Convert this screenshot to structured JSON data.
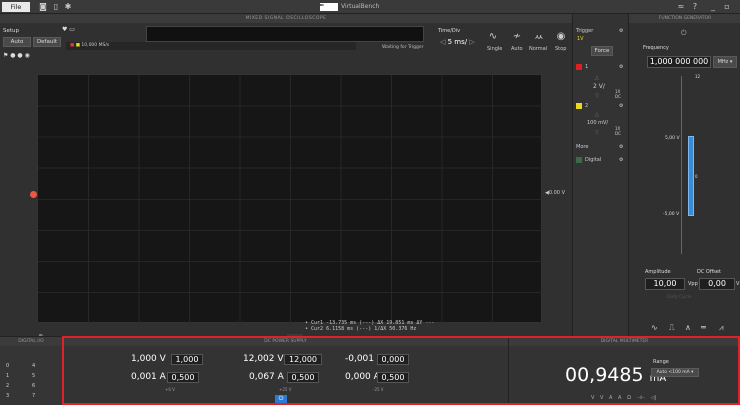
{
  "topbar": {
    "file_label": "File",
    "app_title": "VirtualBench",
    "logo_text": "NATIONAL INSTRUMENTS"
  },
  "scope": {
    "header": "MIXED SIGNAL OSCILLOSCOPE",
    "setup_label": "Setup",
    "auto_label": "Auto",
    "default_label": "Default",
    "sample_rate": "10,000 MS/s",
    "status": "Waiting for Trigger",
    "timediv_label": "Time/Div",
    "timediv_value": "5 ms/",
    "modes": [
      "Single",
      "Auto",
      "Normal",
      "Stop"
    ],
    "ref_label": "0.00 V",
    "cursor_lines": [
      "• Cur1  -13.735 ms (---)   ΔX 19.851 ms   ΔY ---",
      "• Cur2   6.1158 ms (---)   1/ΔX 50.376 Hz"
    ]
  },
  "side": {
    "trigger_label": "Trigger",
    "trigger_level": "1V",
    "force_label": "Force",
    "ch1_label": "1",
    "ch1_scale": "2 V/",
    "ch1_coupling": "1X DC",
    "ch2_label": "2",
    "ch2_scale": "100 mV/",
    "ch2_coupling": "1X DC",
    "more_label": "More",
    "digital_label": "Digital",
    "ch1_color": "#e02020",
    "ch2_color": "#e8d820"
  },
  "fgen": {
    "header": "FUNCTION GENERATOR",
    "frequency_label": "Frequency",
    "frequency_value": "1,000 000 000",
    "frequency_unit": "MHz ▾",
    "top_tick": "12",
    "upper_level": "5,00 V",
    "lower_level": "-5,00 V",
    "mid_tick": "0",
    "amplitude_label": "Amplitude",
    "amplitude_value": "10,00",
    "amplitude_unit": "Vpp",
    "dc_offset_label": "DC Offset",
    "dc_offset_value": "0,00",
    "dc_offset_unit": "V",
    "duty_cycle_label": "Duty Cycle",
    "waveforms": [
      "∿",
      "⎍",
      "∧",
      "═",
      "⩘"
    ]
  },
  "dio": {
    "header": "DIGITAL I/O",
    "pins": [
      "0",
      "1",
      "2",
      "3",
      "4",
      "5",
      "6",
      "7"
    ]
  },
  "dcps": {
    "header": "DC POWER SUPPLY",
    "channels": [
      {
        "voltage": "1,000 V",
        "voltage_set": "1,000",
        "current": "0,001 A",
        "current_set": "0,500",
        "label": "+6 V"
      },
      {
        "voltage": "12,002 V",
        "voltage_set": "12,000",
        "current": "0,067 A",
        "current_set": "0,500",
        "label": "+25 V"
      },
      {
        "voltage": "-0,001 V",
        "voltage_set": "0,000",
        "current": "0,000 A",
        "current_set": "0,500",
        "label": "-25 V"
      }
    ]
  },
  "dmm": {
    "header": "DIGITAL MULTIMETER",
    "value": "00,9485",
    "unit": "mA",
    "range_label": "Range",
    "range_value": "Auto <100 mA ▾",
    "function_icons": [
      "V",
      "V",
      "A",
      "A",
      "Ω",
      "⊣⊢",
      "◁|"
    ]
  }
}
